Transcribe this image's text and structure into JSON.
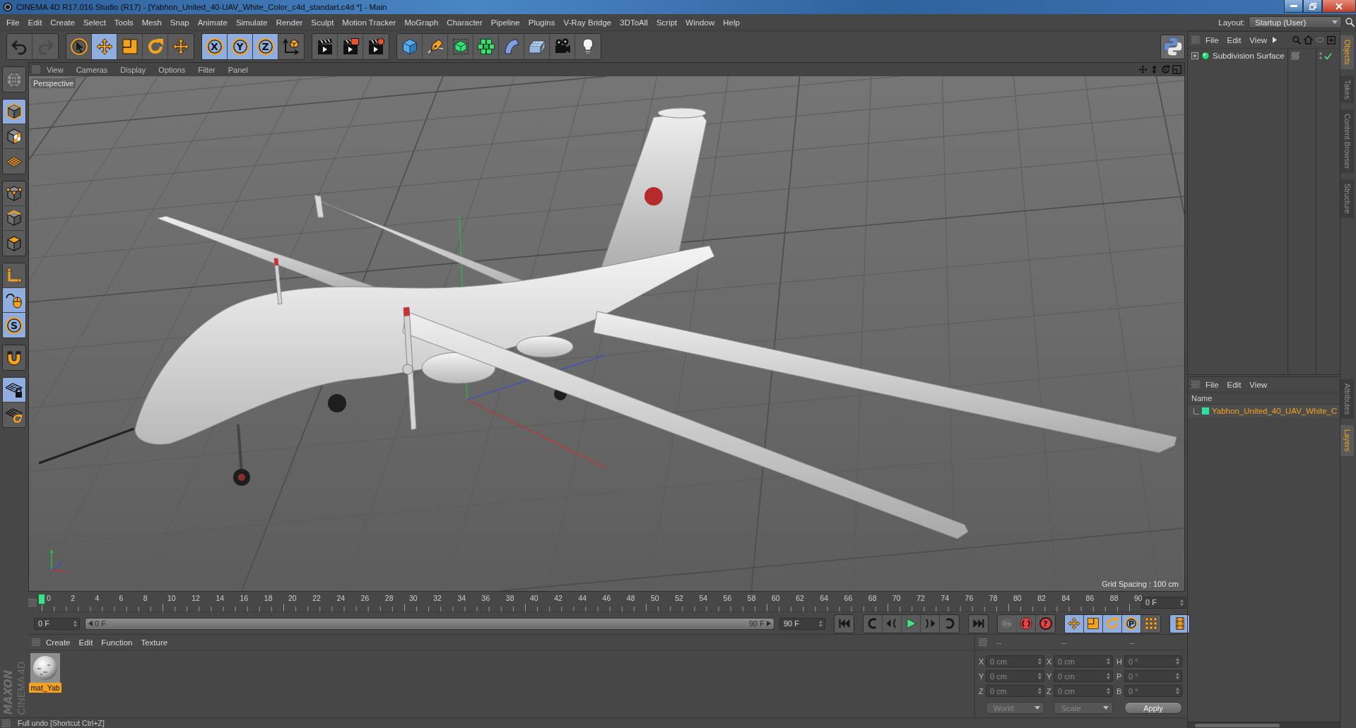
{
  "window": {
    "title": "CINEMA 4D R17.016 Studio (R17) - [Yabhon_United_40-UAV_White_Color_c4d_standart.c4d *] - Main"
  },
  "menu_bar": {
    "items": [
      "File",
      "Edit",
      "Create",
      "Select",
      "Tools",
      "Mesh",
      "Snap",
      "Animate",
      "Simulate",
      "Render",
      "Sculpt",
      "Motion Tracker",
      "MoGraph",
      "Character",
      "Pipeline",
      "Plugins",
      "V-Ray Bridge",
      "3DToAll",
      "Script",
      "Window",
      "Help"
    ],
    "layout_label": "Layout:",
    "layout_value": "Startup (User)"
  },
  "toolbar": {
    "groups": [
      [
        {
          "selected": false,
          "disabled": false
        },
        {
          "selected": false,
          "disabled": true
        }
      ],
      [
        {
          "selected": false,
          "disabled": false
        },
        {
          "selected": true,
          "disabled": false
        },
        {
          "selected": false,
          "disabled": false
        },
        {
          "selected": false,
          "disabled": false
        },
        {
          "selected": false,
          "disabled": false
        }
      ],
      [
        {
          "selected": true,
          "disabled": false,
          "label": "X"
        },
        {
          "selected": true,
          "disabled": false,
          "label": "Y"
        },
        {
          "selected": true,
          "disabled": false,
          "label": "Z"
        },
        {
          "selected": false,
          "disabled": false
        }
      ],
      [
        {
          "selected": false,
          "disabled": false
        },
        {
          "selected": false,
          "disabled": false
        },
        {
          "selected": false,
          "disabled": false
        }
      ],
      [
        {
          "selected": false,
          "disabled": false
        },
        {
          "selected": false,
          "disabled": false
        },
        {
          "selected": false,
          "disabled": false
        },
        {
          "selected": false,
          "disabled": false
        },
        {
          "selected": false,
          "disabled": false
        },
        {
          "selected": false,
          "disabled": false
        },
        {
          "selected": false,
          "disabled": false
        },
        {
          "selected": false,
          "disabled": false
        }
      ]
    ]
  },
  "objects_panel": {
    "menu": [
      "File",
      "Edit",
      "View"
    ],
    "objects": [
      {
        "name": "Subdivision Surface",
        "expanded": false,
        "enabled": true
      }
    ]
  },
  "side_tabs": {
    "upper": [
      {
        "label": "Objects",
        "selected": true
      },
      {
        "label": "Takes",
        "selected": false
      },
      {
        "label": "Content Browser",
        "selected": false
      },
      {
        "label": "Structure",
        "selected": false
      }
    ],
    "lower": [
      {
        "label": "Attributes",
        "selected": false
      },
      {
        "label": "Layers",
        "selected": true
      }
    ]
  },
  "left_toolbar": {
    "groups": [
      [
        {
          "selected": false
        }
      ],
      [
        {
          "selected": true
        },
        {
          "selected": false
        },
        {
          "selected": false
        }
      ],
      [
        {
          "selected": false
        },
        {
          "selected": false
        },
        {
          "selected": false
        }
      ],
      [
        {
          "selected": false
        },
        {
          "selected": true
        },
        {
          "selected": true,
          "label": "S"
        }
      ],
      [
        {
          "selected": false
        }
      ],
      [
        {
          "selected": true
        },
        {
          "selected": false
        }
      ]
    ]
  },
  "viewport": {
    "menu": [
      "View",
      "Cameras",
      "Display",
      "Options",
      "Filter",
      "Panel"
    ],
    "camera": "Perspective",
    "grid_spacing": "Grid Spacing : 100 cm"
  },
  "layers_panel": {
    "menu": [
      "File",
      "Edit",
      "View"
    ],
    "column": "Name",
    "layers": [
      {
        "name": "Yabhon_United_40_UAV_White_C",
        "color": "#2ee0a0"
      }
    ]
  },
  "timeline": {
    "frame_labels": [
      "0",
      "2",
      "4",
      "6",
      "8",
      "10",
      "12",
      "14",
      "16",
      "18",
      "20",
      "22",
      "24",
      "26",
      "28",
      "30",
      "32",
      "34",
      "36",
      "38",
      "40",
      "42",
      "44",
      "46",
      "48",
      "50",
      "52",
      "54",
      "56",
      "58",
      "60",
      "62",
      "64",
      "66",
      "68",
      "70",
      "72",
      "74",
      "76",
      "78",
      "80",
      "82",
      "84",
      "86",
      "88",
      "90"
    ],
    "playhead": {
      "level": 0
    },
    "frame_field": "0 F"
  },
  "transport": {
    "start_field": "0 F",
    "range": {
      "start": "0 F",
      "end": "90 F",
      "level": 1
    },
    "end_field": "90 F",
    "groups": [
      [
        {
          "selected": false,
          "disabled": false
        }
      ],
      [
        {
          "selected": false,
          "disabled": false
        },
        {
          "selected": false,
          "disabled": false
        },
        {
          "selected": false,
          "disabled": false
        },
        {
          "selected": false,
          "disabled": false
        },
        {
          "selected": false,
          "disabled": false
        }
      ],
      [
        {
          "selected": false,
          "disabled": false
        }
      ],
      [
        {
          "selected": false,
          "disabled": true
        },
        {
          "selected": false,
          "disabled": false
        },
        {
          "selected": false,
          "disabled": false,
          "label": "?"
        }
      ],
      [
        {
          "selected": true,
          "disabled": false
        },
        {
          "selected": true,
          "disabled": false
        },
        {
          "selected": true,
          "disabled": false
        },
        {
          "selected": true,
          "disabled": false,
          "label": "P"
        },
        {
          "selected": false,
          "disabled": false
        }
      ],
      [
        {
          "selected": true,
          "disabled": false
        }
      ]
    ]
  },
  "materials_panel": {
    "menu": [
      "Create",
      "Edit",
      "Function",
      "Texture"
    ],
    "materials": [
      {
        "name": "mat_Yab",
        "selected": true
      }
    ]
  },
  "coordinates_panel": {
    "disabled": true,
    "headers": [
      "--",
      "--",
      "--"
    ],
    "rows": [
      {
        "position_label": "X",
        "position": "0 cm",
        "size_label": "X",
        "size": "0 cm",
        "rotation_label": "H",
        "rotation": "0 °"
      },
      {
        "position_label": "Y",
        "position": "0 cm",
        "size_label": "Y",
        "size": "0 cm",
        "rotation_label": "P",
        "rotation": "0 °"
      },
      {
        "position_label": "Z",
        "position": "0 cm",
        "size_label": "Z",
        "size": "0 cm",
        "rotation_label": "B",
        "rotation": "0 °"
      }
    ],
    "mode": "World",
    "transform": "Scale",
    "apply": "Apply"
  },
  "logo": {
    "brand": "MAXON",
    "product": "CINEMA 4D"
  },
  "status_bar": {
    "text": "Full undo [Shortcut Ctrl+Z]"
  }
}
